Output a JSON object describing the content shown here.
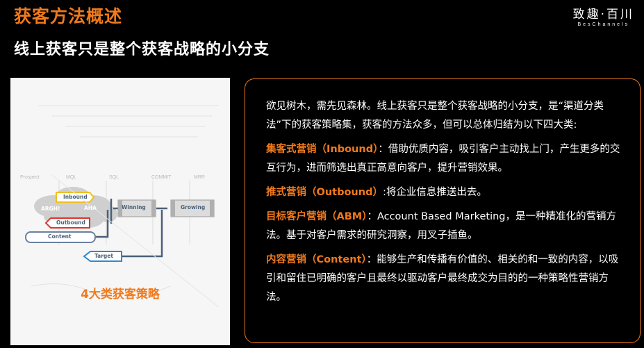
{
  "header": {
    "title": "获客方法概述",
    "subtitle": "线上获客只是整个获客战略的小分支",
    "logo_main": "致趣·百川",
    "logo_sub": "BesChannels"
  },
  "diagram": {
    "stages": [
      "Prospect",
      "MQL",
      "SQL",
      "COMMIT",
      "MRR"
    ],
    "cloud_labels": [
      "ARGH!",
      "AHA"
    ],
    "tags": {
      "inbound": "Inbound",
      "outbound": "Outbound",
      "content": "Content",
      "target": "Target",
      "winning": "Winning",
      "growing": "Growing"
    },
    "caption": "4大类获客策略"
  },
  "content": {
    "intro": "欲见树木，需先见森林。线上获客只是整个获客战略的小分支，是“渠道分类法”下的获客策略集，获客的方法众多，但可以总体归结为以下四大类:",
    "items": [
      {
        "label": "集客式营销（Inbound）",
        "sep": "：",
        "text": "借助优质内容，吸引客户主动找上门，产生更多的交互行为，进而筛选出真正高意向客户，提升营销效果。"
      },
      {
        "label": "推式营销（Outbound）",
        "sep": ":",
        "text": "将企业信息推送出去。"
      },
      {
        "label": "目标客户营销（ABM）",
        "sep": "：",
        "text": "Account Based Marketing，是一种精准化的营销方法。基于对客户需求的研究洞察，用叉子插鱼。"
      },
      {
        "label": "内容营销（Content）",
        "sep": "：",
        "text": "能够生产和传播有价值的、相关的和一致的内容，以吸引和留住已明确的客户且最终以驱动客户最终成交为目的的一种策略性营销方法。"
      }
    ]
  },
  "colors": {
    "accent": "#f07a1c",
    "inbound": "#f0c020",
    "outbound": "#e0332c",
    "content": "#6a7fa0",
    "target": "#2a8bd0"
  }
}
